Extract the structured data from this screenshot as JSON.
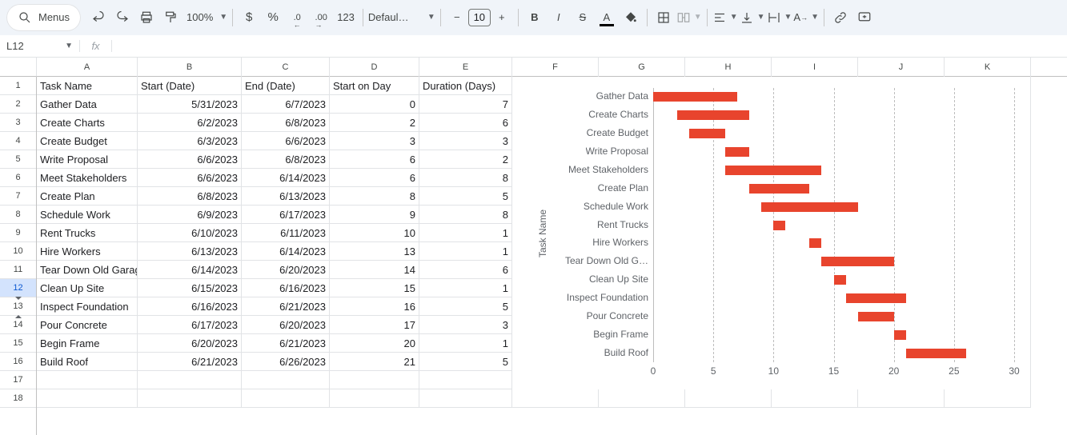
{
  "toolbar": {
    "menus_label": "Menus",
    "zoom": "100%",
    "currency": "$",
    "percent": "%",
    "dec_less": ".0",
    "dec_more": ".00",
    "more_formats": "123",
    "font_name": "Defaul…",
    "font_size": "10",
    "bold": "B",
    "italic": "I",
    "strike": "S",
    "text_color": "A"
  },
  "name_box": "L12",
  "fx_label": "fx",
  "formula": "",
  "columns": [
    "A",
    "B",
    "C",
    "D",
    "E",
    "F",
    "G",
    "H",
    "I",
    "J",
    "K"
  ],
  "row_numbers": [
    "1",
    "2",
    "3",
    "4",
    "5",
    "6",
    "7",
    "8",
    "9",
    "10",
    "11",
    "12",
    "13",
    "14",
    "15",
    "16",
    "17",
    "18"
  ],
  "active_row_index": 11,
  "hidden_after_index": 12,
  "headers": {
    "a": "Task Name",
    "b": "Start (Date)",
    "c": "End (Date)",
    "d": "Start on Day",
    "e": "Duration (Days)"
  },
  "rows": [
    {
      "a": "Gather Data",
      "b": "5/31/2023",
      "c": "6/7/2023",
      "d": "0",
      "e": "7"
    },
    {
      "a": "Create Charts",
      "b": "6/2/2023",
      "c": "6/8/2023",
      "d": "2",
      "e": "6"
    },
    {
      "a": "Create Budget",
      "b": "6/3/2023",
      "c": "6/6/2023",
      "d": "3",
      "e": "3"
    },
    {
      "a": "Write Proposal",
      "b": "6/6/2023",
      "c": "6/8/2023",
      "d": "6",
      "e": "2"
    },
    {
      "a": "Meet Stakeholders",
      "b": "6/6/2023",
      "c": "6/14/2023",
      "d": "6",
      "e": "8"
    },
    {
      "a": "Create Plan",
      "b": "6/8/2023",
      "c": "6/13/2023",
      "d": "8",
      "e": "5"
    },
    {
      "a": "Schedule Work",
      "b": "6/9/2023",
      "c": "6/17/2023",
      "d": "9",
      "e": "8"
    },
    {
      "a": "Rent Trucks",
      "b": "6/10/2023",
      "c": "6/11/2023",
      "d": "10",
      "e": "1"
    },
    {
      "a": "Hire Workers",
      "b": "6/13/2023",
      "c": "6/14/2023",
      "d": "13",
      "e": "1"
    },
    {
      "a": "Tear Down Old Garage",
      "b": "6/14/2023",
      "c": "6/20/2023",
      "d": "14",
      "e": "6"
    },
    {
      "a": "Clean Up Site",
      "b": "6/15/2023",
      "c": "6/16/2023",
      "d": "15",
      "e": "1"
    },
    {
      "a": "Inspect Foundation",
      "b": "6/16/2023",
      "c": "6/21/2023",
      "d": "16",
      "e": "5"
    },
    {
      "a": "Pour Concrete",
      "b": "6/17/2023",
      "c": "6/20/2023",
      "d": "17",
      "e": "3"
    },
    {
      "a": "Begin Frame",
      "b": "6/20/2023",
      "c": "6/21/2023",
      "d": "20",
      "e": "1"
    },
    {
      "a": "Build Roof",
      "b": "6/21/2023",
      "c": "6/26/2023",
      "d": "21",
      "e": "5"
    }
  ],
  "chart_data": {
    "type": "bar",
    "orientation": "horizontal",
    "stacked": true,
    "y_axis_title": "Task Name",
    "categories": [
      "Gather Data",
      "Create Charts",
      "Create Budget",
      "Write Proposal",
      "Meet Stakeholders",
      "Create Plan",
      "Schedule Work",
      "Rent Trucks",
      "Hire Workers",
      "Tear Down Old G…",
      "Clean Up Site",
      "Inspect Foundation",
      "Pour Concrete",
      "Begin Frame",
      "Build Roof"
    ],
    "series": [
      {
        "name": "Start on Day",
        "color": "transparent",
        "values": [
          0,
          2,
          3,
          6,
          6,
          8,
          9,
          10,
          13,
          14,
          15,
          16,
          17,
          20,
          21
        ]
      },
      {
        "name": "Duration (Days)",
        "color": "#e8442d",
        "values": [
          7,
          6,
          3,
          2,
          8,
          5,
          8,
          1,
          1,
          6,
          1,
          5,
          3,
          1,
          5
        ]
      }
    ],
    "xlim": [
      0,
      30
    ],
    "x_ticks": [
      0,
      5,
      10,
      15,
      20,
      25,
      30
    ]
  }
}
